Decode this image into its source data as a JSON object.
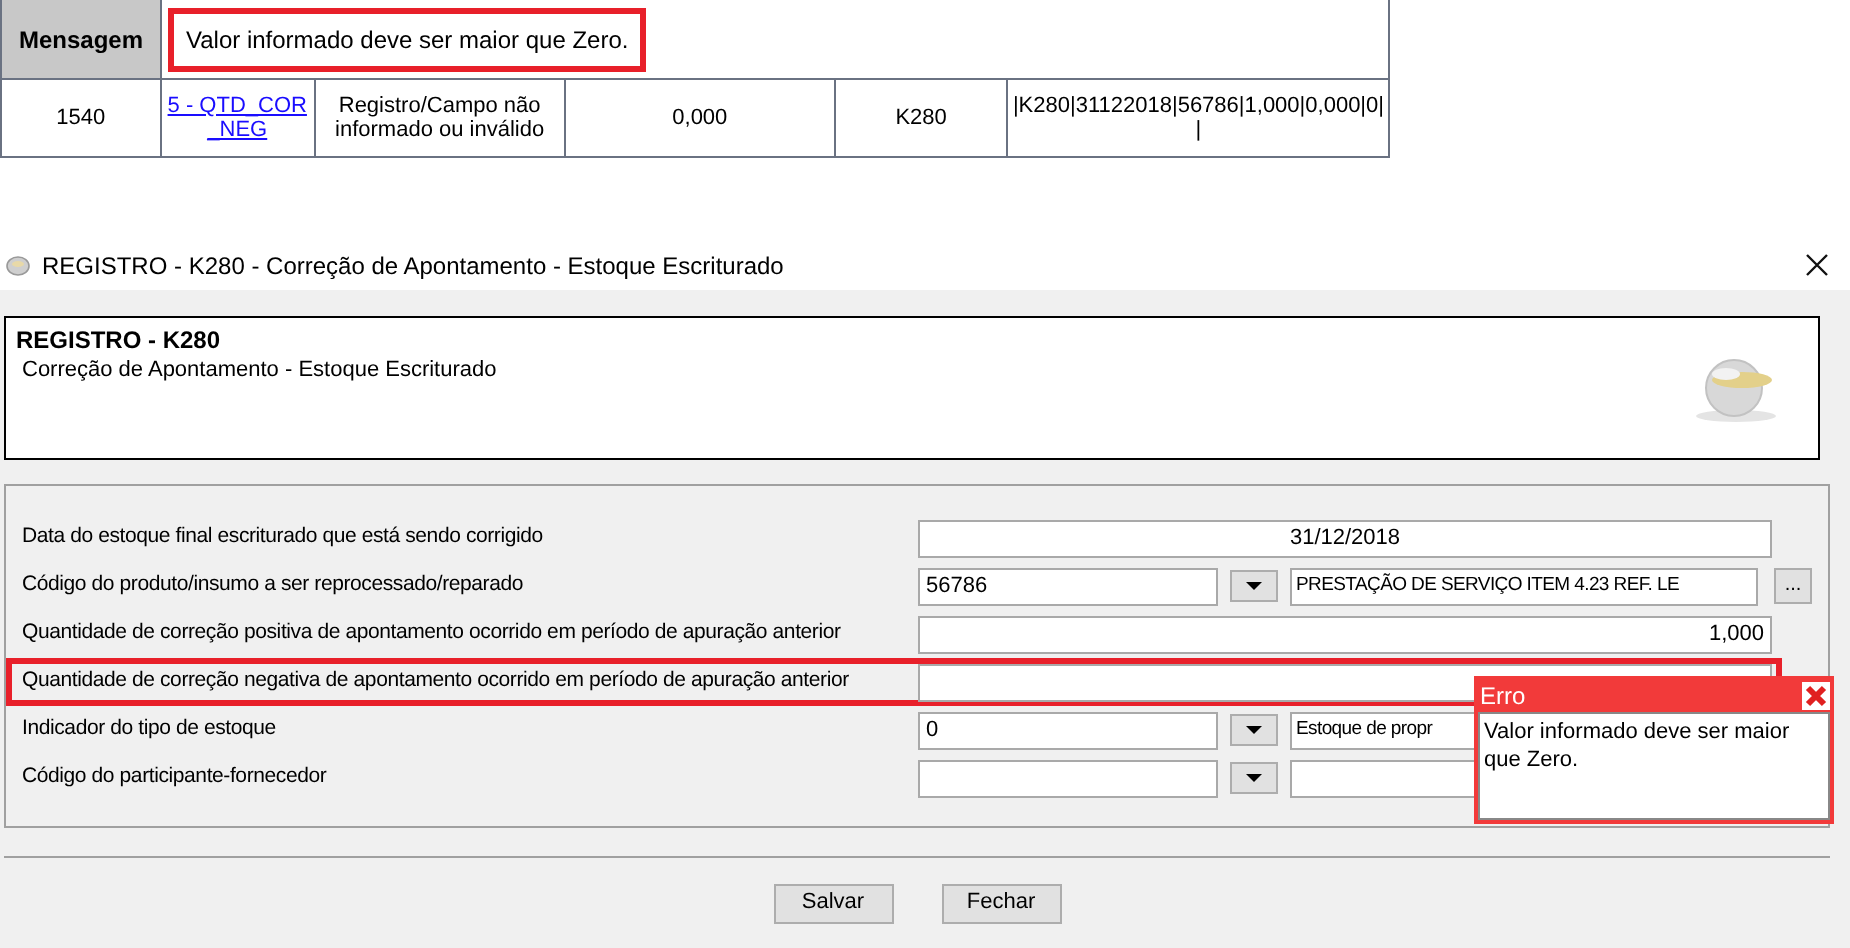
{
  "report": {
    "message_label": "Mensagem",
    "message": "Valor informado deve ser maior que Zero.",
    "message_highlighted": true,
    "row": [
      {
        "kind": "text",
        "text": "1540"
      },
      {
        "kind": "link",
        "text": "5 - QTD_COR_NEG"
      },
      {
        "kind": "text",
        "text": "Registro/Campo não informado ou inválido"
      },
      {
        "kind": "text",
        "text": "0,000"
      },
      {
        "kind": "text",
        "text": "K280"
      },
      {
        "kind": "text",
        "text": "|K280|31122018|56786|1,000|0,000|0| |"
      }
    ]
  },
  "window": {
    "title": "REGISTRO - K280 - Correção de Apontamento - Estoque Escriturado",
    "header": {
      "title": "REGISTRO - K280",
      "subtitle": "Correção de Apontamento - Estoque Escriturado"
    },
    "fields": [
      {
        "kind": "date",
        "label": "Data do estoque final escriturado que está sendo corrigido",
        "value": "31/12/2018",
        "highlighted": false
      },
      {
        "kind": "lookup",
        "label": "Código do produto/insumo a  ser reprocessado/reparado",
        "value": "56786",
        "description": "PRESTAÇÃO DE SERVIÇO ITEM  4.23 REF. LE",
        "browse": "...",
        "highlighted": false
      },
      {
        "kind": "number",
        "label": "Quantidade de correção positiva de apontamento ocorrido em período de apuração anterior",
        "value": "1,000",
        "highlighted": false
      },
      {
        "kind": "number",
        "label": "Quantidade de correção negativa de apontamento ocorrido em período de apuração anterior",
        "highlighted": true
      },
      {
        "kind": "combo",
        "label": "Indicador do tipo de estoque",
        "value": "0",
        "description": "Estoque de propr",
        "highlighted": false
      },
      {
        "kind": "combo",
        "label": "Código do participante-fornecedor",
        "highlighted": false
      }
    ],
    "buttons": [
      "Salvar",
      "Fechar"
    ],
    "error": {
      "title": "Erro",
      "message": "Valor informado deve ser maior que Zero."
    }
  }
}
